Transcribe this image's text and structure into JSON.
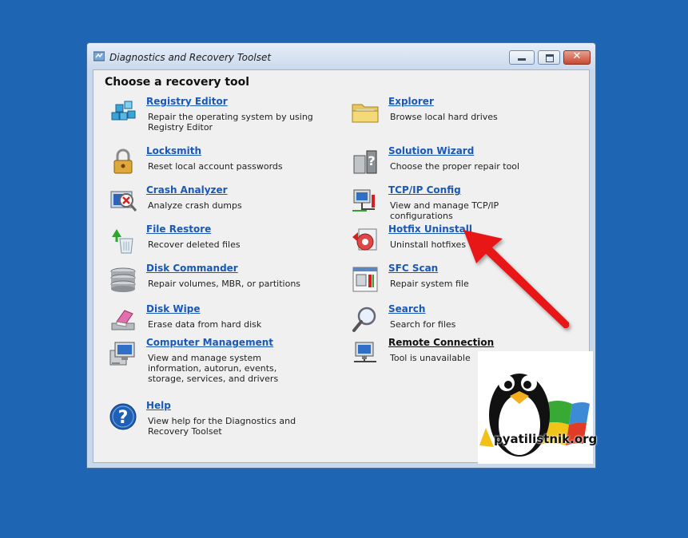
{
  "window": {
    "title": "Diagnostics and Recovery Toolset",
    "close_glyph": "✕"
  },
  "main": {
    "heading": "Choose a recovery tool",
    "left": [
      {
        "label": "Registry Editor",
        "desc": "Repair the operating system by using Registry Editor",
        "icon": "registry-cubes-icon"
      },
      {
        "label": "Locksmith",
        "desc": "Reset local account passwords",
        "icon": "padlock-icon"
      },
      {
        "label": "Crash Analyzer",
        "desc": "Analyze crash dumps",
        "icon": "crash-analyzer-icon"
      },
      {
        "label": "File Restore",
        "desc": "Recover deleted files",
        "icon": "recycle-bin-icon"
      },
      {
        "label": "Disk Commander",
        "desc": "Repair volumes, MBR, or partitions",
        "icon": "disk-stack-icon"
      },
      {
        "label": "Disk Wipe",
        "desc": "Erase data from hard disk",
        "icon": "eraser-icon"
      },
      {
        "label": "Computer Management",
        "desc": "View and manage system information, autorun, events, storage, services, and drivers",
        "icon": "computer-management-icon"
      },
      {
        "label": "Help",
        "desc": "View help for the Diagnostics and Recovery Toolset",
        "icon": "help-icon"
      }
    ],
    "right": [
      {
        "label": "Explorer",
        "desc": "Browse local hard drives",
        "icon": "folder-icon"
      },
      {
        "label": "Solution Wizard",
        "desc": "Choose the proper repair tool",
        "icon": "wizard-icon"
      },
      {
        "label": "TCP/IP Config",
        "desc": "View and manage TCP/IP configurations",
        "icon": "network-config-icon"
      },
      {
        "label": "Hotfix Uninstall",
        "desc": "Uninstall hotfixes",
        "icon": "hotfix-uninstall-icon"
      },
      {
        "label": "SFC Scan",
        "desc": "Repair system file",
        "icon": "sfc-scan-icon"
      },
      {
        "label": "Search",
        "desc": "Search for files",
        "icon": "magnifier-icon"
      },
      {
        "label": "Remote Connection",
        "desc": "Tool is unavailable",
        "icon": "remote-connection-icon"
      }
    ]
  },
  "watermark": {
    "text": "pyatilistnik.org"
  },
  "colors": {
    "desktop": "#1e65b4",
    "link": "#1a58b8",
    "arrow": "#e81919"
  }
}
